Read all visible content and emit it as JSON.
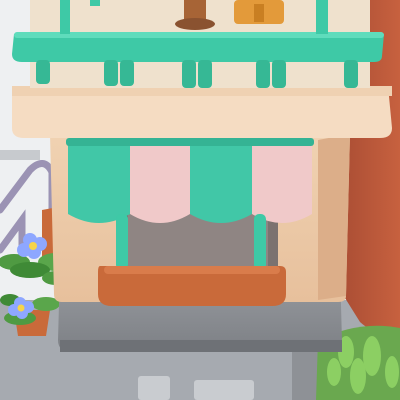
{
  "scene": {
    "subject": "storefront-kiosk",
    "colors": {
      "background": "#eef0f2",
      "ground": "#a9adb2",
      "railing_teal": "#3ec9a6",
      "railing_teal_dark": "#2aa98a",
      "wall_cream": "#f3dcc4",
      "wall_tan": "#e9c3a0",
      "wall_shadow": "#d6a985",
      "awning_teal": "#41c7a7",
      "awning_pink": "#f0c9c9",
      "counter": "#c96a3a",
      "base_gray": "#8b8e93",
      "base_gray_dark": "#6e7176",
      "brick_red": "#b8573a",
      "grass": "#6aa84f",
      "leaf": "#5aa64b",
      "flower_petal": "#8ea7ff",
      "flower_center": "#f6d44a",
      "rail_lavender": "#9b93b4",
      "wood": "#a76436",
      "chair": "#e39a3a"
    }
  }
}
